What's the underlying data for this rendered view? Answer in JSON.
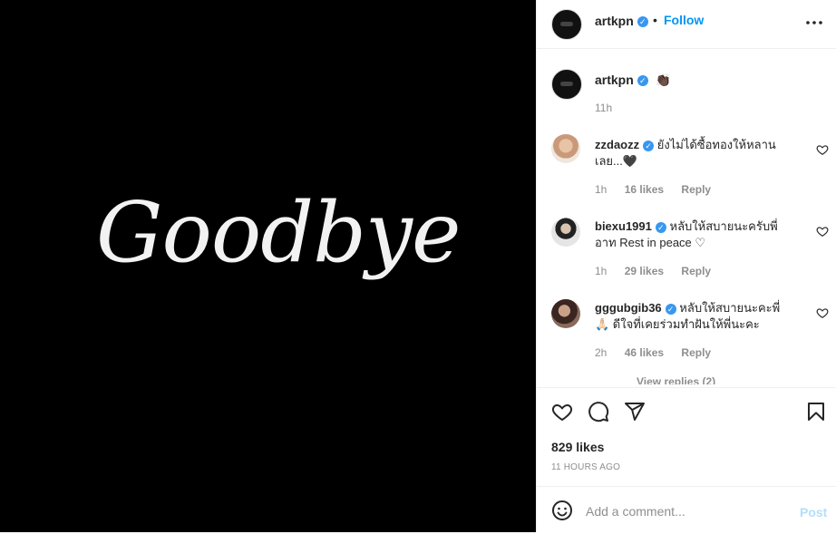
{
  "post": {
    "image_text": "Goodbye"
  },
  "header": {
    "username": "artkpn",
    "dot": "•",
    "follow_label": "Follow"
  },
  "caption": {
    "username": "artkpn",
    "emoji": "👏🏿",
    "time": "11h"
  },
  "comments": [
    {
      "username": "zzdaozz",
      "line1": "ยังไม่ได้ซื้อทองให้หลาน",
      "line2": "เลย...🖤",
      "time": "1h",
      "likes": "16 likes",
      "reply": "Reply"
    },
    {
      "username": "biexu1991",
      "line1": "หลับให้สบายนะครับพี่",
      "line2": "อาท Rest in peace ♡",
      "time": "1h",
      "likes": "29 likes",
      "reply": "Reply"
    },
    {
      "username": "gggubgib36",
      "line1": "หลับให้สบายนะคะพี่",
      "line2": "🙏🏻 ดีใจที่เคยร่วมทำฝันให้พี่นะคะ",
      "time": "2h",
      "likes": "46 likes",
      "reply": "Reply"
    }
  ],
  "view_replies": "View replies (2)",
  "likes_count": "829 likes",
  "time_ago": "11 HOURS AGO",
  "add_comment": {
    "placeholder": "Add a comment...",
    "post_label": "Post"
  },
  "colors": {
    "accent": "#0095f6",
    "verified": "#3897f0",
    "post_disabled": "#b2dffc"
  },
  "icons": [
    "more-options-icon",
    "heart-icon",
    "comment-icon",
    "share-icon",
    "bookmark-icon",
    "emoji-icon",
    "verified-badge-icon"
  ]
}
